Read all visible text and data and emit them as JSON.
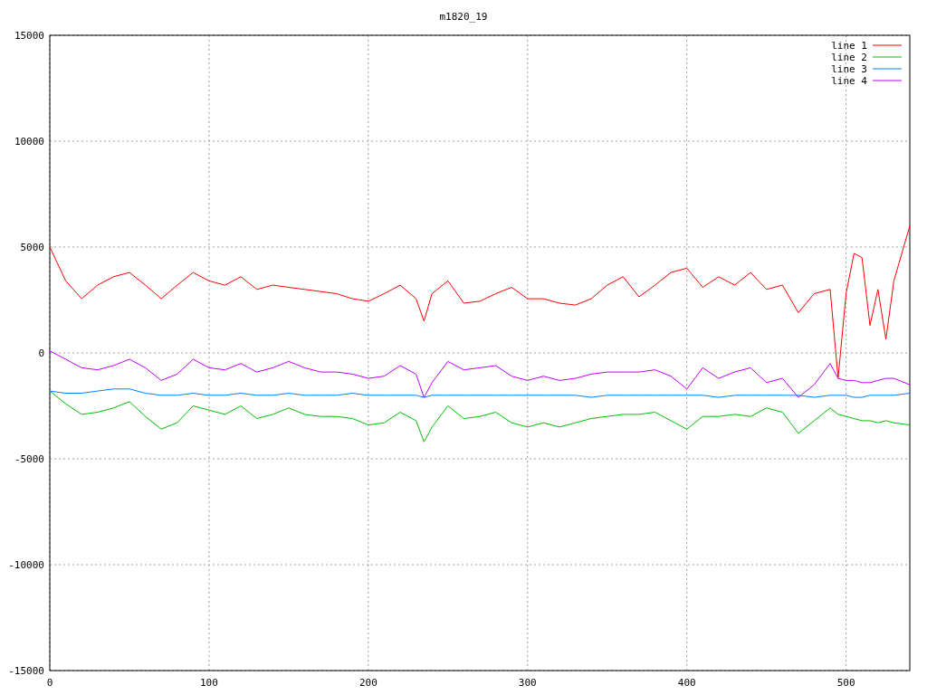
{
  "chart_data": {
    "type": "line",
    "title": "m1820_19",
    "x": [
      0,
      10,
      20,
      30,
      40,
      50,
      60,
      70,
      80,
      90,
      100,
      110,
      120,
      130,
      140,
      150,
      160,
      170,
      180,
      190,
      200,
      210,
      220,
      230,
      235,
      240,
      250,
      260,
      270,
      280,
      290,
      300,
      310,
      320,
      330,
      340,
      350,
      360,
      370,
      380,
      390,
      400,
      410,
      420,
      430,
      440,
      450,
      460,
      470,
      480,
      490,
      495,
      500,
      505,
      510,
      515,
      520,
      525,
      530,
      540
    ],
    "grid": true,
    "legend": true,
    "xlim": [
      0,
      540
    ],
    "ylim": [
      -15000,
      15000
    ],
    "xticks": [
      0,
      100,
      200,
      300,
      400,
      500
    ],
    "yticks": [
      -15000,
      -10000,
      -5000,
      0,
      5000,
      10000,
      15000
    ],
    "series": [
      {
        "name": "line 1",
        "color": "#ff0000",
        "values": [
          5000,
          3400,
          2560,
          3200,
          3600,
          3800,
          3200,
          2560,
          3200,
          3800,
          3400,
          3200,
          3600,
          3000,
          3200,
          3100,
          3000,
          2900,
          2800,
          2560,
          2440,
          2800,
          3200,
          2560,
          1500,
          2800,
          3400,
          2350,
          2440,
          2800,
          3100,
          2560,
          2560,
          2350,
          2260,
          2560,
          3200,
          3600,
          2650,
          3200,
          3800,
          4000,
          3100,
          3600,
          3200,
          3800,
          3000,
          3200,
          1900,
          2800,
          3000,
          -1200,
          2800,
          4700,
          4500,
          1300,
          3000,
          640,
          3400,
          6000
        ]
      },
      {
        "name": "line 2",
        "color": "#00c000",
        "values": [
          -1800,
          -2400,
          -2900,
          -2800,
          -2600,
          -2300,
          -3000,
          -3600,
          -3300,
          -2500,
          -2700,
          -2900,
          -2500,
          -3100,
          -2900,
          -2600,
          -2900,
          -3000,
          -3000,
          -3100,
          -3400,
          -3300,
          -2800,
          -3200,
          -4200,
          -3500,
          -2500,
          -3100,
          -3000,
          -2800,
          -3300,
          -3500,
          -3300,
          -3500,
          -3300,
          -3100,
          -3000,
          -2900,
          -2900,
          -2800,
          -3200,
          -3600,
          -3000,
          -3000,
          -2900,
          -3000,
          -2600,
          -2800,
          -3800,
          -3200,
          -2600,
          -2900,
          -3000,
          -3100,
          -3200,
          -3200,
          -3300,
          -3200,
          -3300,
          -3400
        ]
      },
      {
        "name": "line 3",
        "color": "#0080ff",
        "values": [
          -1800,
          -1900,
          -1900,
          -1800,
          -1700,
          -1700,
          -1900,
          -2000,
          -2000,
          -1900,
          -2000,
          -2000,
          -1900,
          -2000,
          -2000,
          -1900,
          -2000,
          -2000,
          -2000,
          -1900,
          -2000,
          -2000,
          -2000,
          -2000,
          -2100,
          -2000,
          -2000,
          -2000,
          -2000,
          -2000,
          -2000,
          -2000,
          -2000,
          -2000,
          -2000,
          -2100,
          -2000,
          -2000,
          -2000,
          -2000,
          -2000,
          -2000,
          -2000,
          -2100,
          -2000,
          -2000,
          -2000,
          -2000,
          -2000,
          -2100,
          -2000,
          -2000,
          -2000,
          -2100,
          -2100,
          -2000,
          -2000,
          -2000,
          -2000,
          -1900
        ]
      },
      {
        "name": "line 4",
        "color": "#c000ff",
        "values": [
          100,
          -300,
          -700,
          -800,
          -600,
          -300,
          -700,
          -1300,
          -1000,
          -300,
          -700,
          -800,
          -500,
          -900,
          -700,
          -400,
          -700,
          -900,
          -900,
          -1000,
          -1200,
          -1100,
          -600,
          -1000,
          -2100,
          -1400,
          -400,
          -800,
          -700,
          -600,
          -1100,
          -1300,
          -1100,
          -1300,
          -1200,
          -1000,
          -900,
          -900,
          -900,
          -800,
          -1100,
          -1700,
          -700,
          -1200,
          -900,
          -700,
          -1400,
          -1200,
          -2100,
          -1500,
          -500,
          -1200,
          -1300,
          -1300,
          -1400,
          -1400,
          -1300,
          -1200,
          -1200,
          -1500
        ]
      }
    ]
  }
}
